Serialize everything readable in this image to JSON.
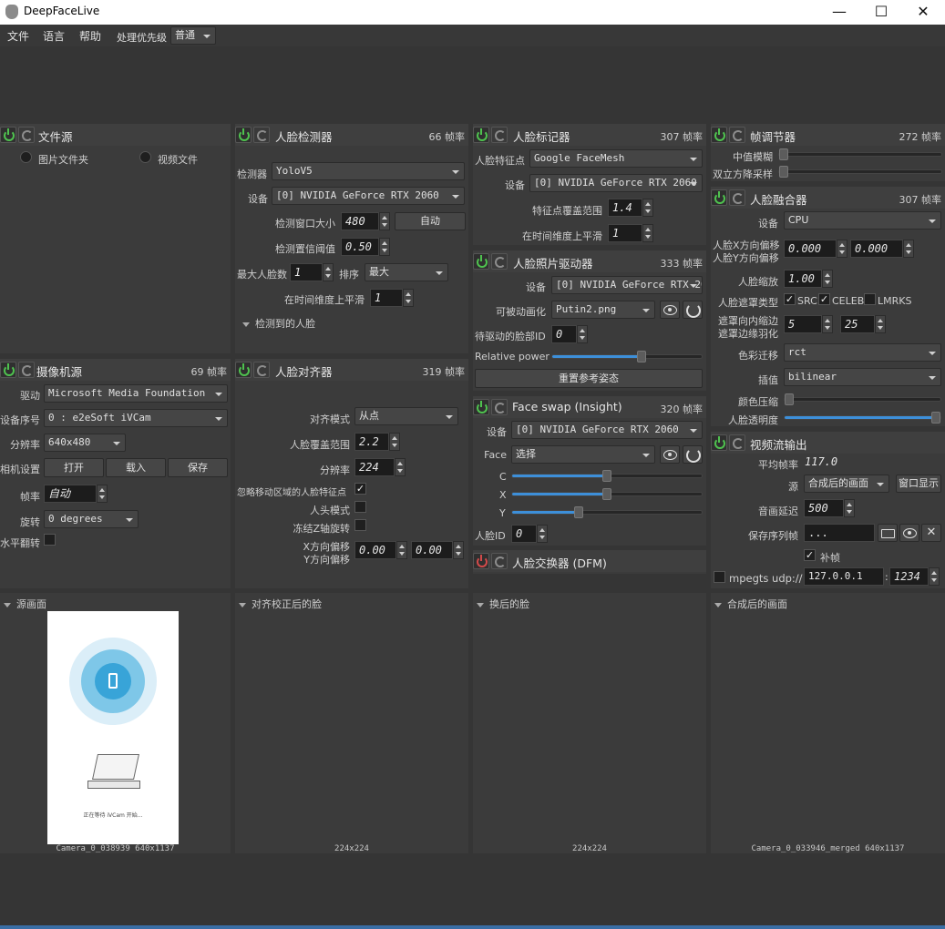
{
  "window": {
    "title": "DeepFaceLive",
    "minimize": "—",
    "maximize": "☐",
    "close": "✕"
  },
  "menu": {
    "file": "文件",
    "language": "语言",
    "help": "帮助",
    "priority_label": "处理优先级",
    "priority_value": "普通"
  },
  "file_source": {
    "title": "文件源",
    "opt_folder": "图片文件夹",
    "opt_video": "视频文件"
  },
  "face_detector": {
    "title": "人脸检测器",
    "fps": "66 帧率",
    "detector_label": "检测器",
    "detector_value": "YoloV5",
    "device_label": "设备",
    "device_value": "[0] NVIDIA GeForce RTX 2060",
    "window_label": "检测窗口大小",
    "window_value": "480",
    "auto": "自动",
    "threshold_label": "检测置信阈值",
    "threshold_value": "0.50",
    "max_faces_label": "最大人脸数",
    "max_faces_value": "1",
    "sort_label": "排序",
    "sort_value": "最大",
    "temporal_label": "在时间维度上平滑",
    "temporal_value": "1",
    "detected": "检测到的人脸"
  },
  "face_marker": {
    "title": "人脸标记器",
    "fps": "307 帧率",
    "marker_label": "人脸特征点",
    "marker_value": "Google FaceMesh",
    "device_label": "设备",
    "device_value": "[0] NVIDIA GeForce RTX 2060",
    "range_label": "特征点覆盖范围",
    "range_value": "1.4",
    "temporal_label": "在时间维度上平滑",
    "temporal_value": "1"
  },
  "frame_adjuster": {
    "title": "帧调节器",
    "fps": "272 帧率",
    "median_label": "中值模糊",
    "median_level": 0.0,
    "bilateral_label": "双立方降采样",
    "bilateral_level": 0.0
  },
  "face_merger": {
    "title": "人脸融合器",
    "fps": "307 帧率",
    "device_label": "设备",
    "device_value": "CPU",
    "offx_label": "人脸X方向偏移",
    "offy_label": "人脸Y方向偏移",
    "offx_value": "0.000",
    "offy_value": "0.000",
    "scale_label": "人脸缩放",
    "scale_value": "1.00",
    "mask_label": "人脸遮罩类型",
    "src": "SRC",
    "celeb": "CELEB",
    "lmrks": "LMRKS",
    "src_checked": "✓",
    "celeb_checked": "✓",
    "erode_label": "遮罩向内缩边",
    "blur_label": "遮罩边缘羽化",
    "erode_value": "5",
    "blur_value": "25",
    "color_label": "色彩迁移",
    "color_value": "rct",
    "interp_label": "插值",
    "interp_value": "bilinear",
    "compress_label": "颜色压缩",
    "compress_level": 0.0,
    "opacity_label": "人脸透明度",
    "opacity_level": 1.0
  },
  "camera": {
    "title": "摄像机源",
    "fps": "69 帧率",
    "driver_label": "驱动",
    "driver_value": "Microsoft Media Foundation",
    "index_label": "设备序号",
    "index_value": "0 : e2eSoft iVCam",
    "res_label": "分辨率",
    "res_value": "640x480",
    "settings_label": "相机设置",
    "open": "打开",
    "load": "载入",
    "save": "保存",
    "fps_label": "帧率",
    "fps_value": "自动",
    "rotate_label": "旋转",
    "rotate_value": "0 degrees",
    "flip_label": "水平翻转"
  },
  "aligner": {
    "title": "人脸对齐器",
    "fps": "319 帧率",
    "mode_label": "对齐模式",
    "mode_value": "从点",
    "coverage_label": "人脸覆盖范围",
    "coverage_value": "2.2",
    "res_label": "分辨率",
    "res_value": "224",
    "exclude_label": "忽略移动区域的人脸特征点",
    "exclude_checked": "✓",
    "head_label": "人头模式",
    "freeze_label": "冻结Z轴旋转",
    "offx_label": "X方向偏移",
    "offy_label": "Y方向偏移",
    "offx_value": "0.00",
    "offy_value": "0.00"
  },
  "animator": {
    "title": "人脸照片驱动器",
    "fps": "333 帧率",
    "device_label": "设备",
    "device_value": "[0] NVIDIA GeForce RTX 2060",
    "anim_label": "可被动画化",
    "anim_value": "Putin2.png",
    "driver_id_label": "待驱动的脸部ID",
    "driver_id_value": "0",
    "power_label": "Relative power",
    "power_level": 0.6,
    "reset": "重置参考姿态"
  },
  "swap_insight": {
    "title": "Face swap (Insight)",
    "fps": "320 帧率",
    "device_label": "设备",
    "device_value": "[0] NVIDIA GeForce RTX 2060",
    "face_label": "Face",
    "face_value": "选择",
    "c_label": "C",
    "c_level": 0.5,
    "x_label": "X",
    "x_level": 0.5,
    "y_label": "Y",
    "y_level": 0.35,
    "id_label": "人脸ID",
    "id_value": "0"
  },
  "swapper_dfm": {
    "title": "人脸交换器 (DFM)"
  },
  "stream_output": {
    "title": "视频流输出",
    "avg_label": "平均帧率",
    "avg_value": "117.0",
    "source_label": "源",
    "source_value": "合成后的画面",
    "window_btn": "窗口显示",
    "delay_label": "音画延迟",
    "delay_value": "500",
    "seq_label": "保存序列帧",
    "seq_value": "...",
    "fill_label": "补帧",
    "fill_checked": "✓",
    "mpegts_label": "mpegts udp://",
    "ip_value": "127.0.0.1",
    "port_sep": ":",
    "port_value": "1234"
  },
  "views": {
    "source_title": "源画面",
    "source_caption": "Camera_0_038939 640x1137",
    "aligned_title": "对齐校正后的脸",
    "aligned_caption": "224x224",
    "swapped_title": "换后的脸",
    "swapped_caption": "224x224",
    "merged_title": "合成后的画面",
    "merged_caption": "Camera_0_033946_merged 640x1137",
    "preview_text": "正在等待 iVCam 开始..."
  }
}
